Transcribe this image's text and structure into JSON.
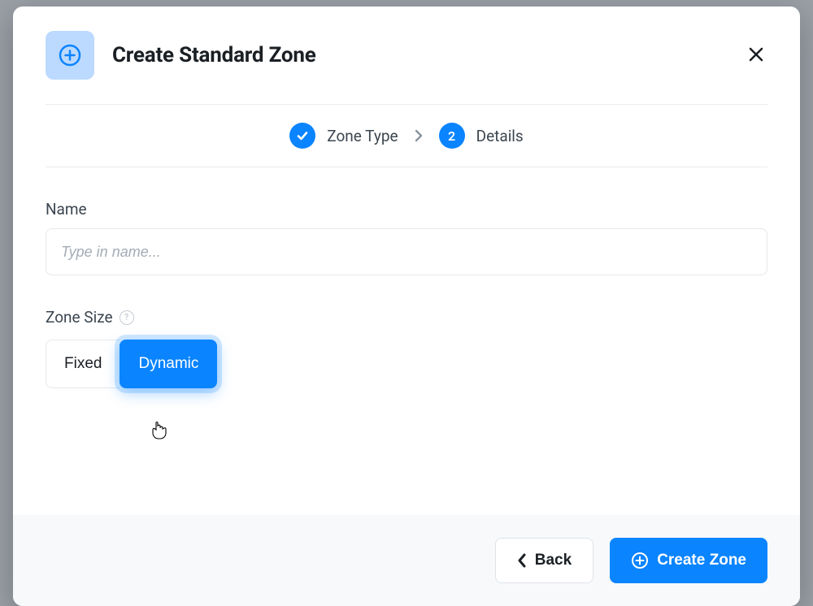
{
  "modal": {
    "title": "Create Standard Zone"
  },
  "stepper": {
    "steps": [
      {
        "label": "Zone Type"
      },
      {
        "number": "2",
        "label": "Details"
      }
    ]
  },
  "form": {
    "name_label": "Name",
    "name_placeholder": "Type in name...",
    "zone_size_label": "Zone Size",
    "size_options": {
      "fixed": "Fixed",
      "dynamic": "Dynamic"
    },
    "size_selected": "dynamic"
  },
  "footer": {
    "back_label": "Back",
    "create_label": "Create Zone"
  }
}
